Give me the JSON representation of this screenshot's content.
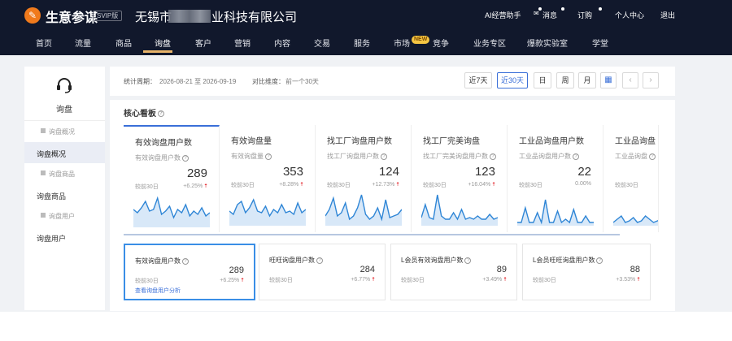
{
  "header": {
    "brand": "生意参谋",
    "vip_badge": "SVIP版",
    "company_prefix": "无锡市",
    "company_suffix": "业科技有限公司",
    "links": [
      "AI经营助手",
      "消息",
      "订购",
      "个人中心",
      "退出"
    ]
  },
  "nav": {
    "items": [
      "首页",
      "流量",
      "商品",
      "询盘",
      "客户",
      "营销",
      "内容",
      "交易",
      "服务",
      "市场",
      "竞争",
      "业务专区",
      "爆款实验室",
      "学堂"
    ],
    "active": "询盘",
    "new_badge": "NEW"
  },
  "sidebar": {
    "title": "询盘",
    "entries": [
      {
        "label": "询盘概况",
        "type": "sub"
      },
      {
        "label": "询盘概况",
        "type": "item",
        "active": true
      },
      {
        "label": "询盘商品",
        "type": "sub"
      },
      {
        "label": "询盘商品",
        "type": "item"
      },
      {
        "label": "询盘用户",
        "type": "sub"
      },
      {
        "label": "询盘用户",
        "type": "item"
      }
    ]
  },
  "stat": {
    "period_label": "统计周期：",
    "period_value": "2026-08-21 至 2026-09-19",
    "compare_label": "对比维度：",
    "compare_value": "前一个30天",
    "ranges": [
      "近7天",
      "近30天",
      "日",
      "周",
      "月"
    ],
    "active_range": "近30天",
    "calendar_icon": "calendar-icon",
    "prev_icon": "chevron-left-icon",
    "next_icon": "chevron-right-icon"
  },
  "core": {
    "title": "核心看板",
    "cards": [
      {
        "title": "有效询盘用户数",
        "sub": "有效询盘用户数",
        "value": "289",
        "cmp": "较前30日",
        "pct": "+6.25%",
        "up": true
      },
      {
        "title": "有效询盘量",
        "sub": "有效询盘量",
        "value": "353",
        "cmp": "较前30日",
        "pct": "+8.28%",
        "up": true
      },
      {
        "title": "找工厂询盘用户数",
        "sub": "找工厂询盘用户数",
        "value": "124",
        "cmp": "较前30日",
        "pct": "+12.73%",
        "up": true
      },
      {
        "title": "找工厂完美询盘",
        "sub": "找工厂完美询盘用户数",
        "value": "123",
        "cmp": "较前30日",
        "pct": "+16.04%",
        "up": true
      },
      {
        "title": "工业品询盘用户数",
        "sub": "工业品询盘用户数",
        "value": "22",
        "cmp": "较前30日",
        "pct": "0.00%",
        "up": false
      },
      {
        "title": "工业品询盘",
        "sub": "工业品询盘",
        "value": "",
        "cmp": "较前30日",
        "pct": "",
        "up": false
      }
    ]
  },
  "bottom_cards": [
    {
      "title": "有效询盘用户数",
      "value": "289",
      "cmp": "较前30日",
      "pct": "+6.25%",
      "link": "查看询盘用户分析"
    },
    {
      "title": "旺旺询盘用户数",
      "value": "284",
      "cmp": "较前30日",
      "pct": "+6.77%",
      "link": ""
    },
    {
      "title": "L会员有效询盘用户数",
      "value": "89",
      "cmp": "较前30日",
      "pct": "+3.49%",
      "link": ""
    },
    {
      "title": "L会员旺旺询盘用户数",
      "value": "88",
      "cmp": "较前30日",
      "pct": "+3.53%",
      "link": ""
    }
  ],
  "colors": {
    "header_bg": "#11182c",
    "accent": "#3a6fd8",
    "up": "#e5333a",
    "nav_underline": "#e8b46a"
  }
}
